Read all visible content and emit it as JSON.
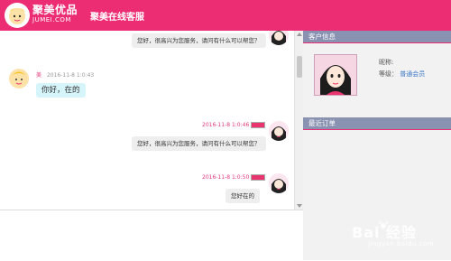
{
  "header": {
    "brand": "聚美优品",
    "brand_sub": "JUMEI.COM",
    "title": "聚美在线客服"
  },
  "messages": [
    {
      "side": "right",
      "text": "您好，很高兴为您服务，请问有什么可以帮您？"
    },
    {
      "side": "left",
      "name": "美",
      "time": "2016-11-8 1:0:43",
      "text": "你好，在的"
    },
    {
      "side": "right",
      "time": "2016-11-8 1:0:46",
      "text": "您好，很高兴为您服务，请问有什么可以帮您？"
    },
    {
      "side": "right",
      "time": "2016-11-8 1:0:50",
      "text": "您好在的"
    }
  ],
  "sidebar": {
    "customer_title": "客户信息",
    "nickname_label": "昵称:",
    "level_label": "等级：",
    "level_value": "普通会员",
    "orders_title": "最近订单"
  },
  "watermark": {
    "text": "Bai 经验",
    "sub": "jingyan.baidu.com"
  },
  "colors": {
    "brand": "#ec2c73",
    "panel_header": "#8a92b2",
    "timestamp": "#e33a7a"
  }
}
